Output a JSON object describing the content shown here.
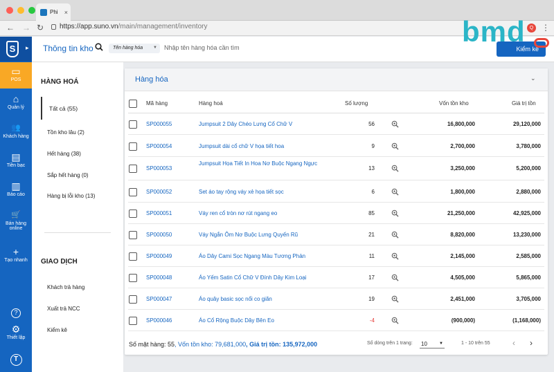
{
  "browser": {
    "tab_title": "Phi",
    "tab_close": "×",
    "url_host": "https://app.suno.vn",
    "url_path": "/main/management/inventory",
    "ext_badge": "Q",
    "back_icon": "←",
    "forward_icon": "→",
    "reload_icon": "↻",
    "menu_icon": "⋮"
  },
  "watermark": {
    "text": "bmd"
  },
  "sidebar": {
    "logo_letter": "S",
    "items": [
      {
        "icon": "monitor-icon",
        "glyph": "▭",
        "label": "POS"
      },
      {
        "icon": "home-icon",
        "glyph": "⌂",
        "label": "Quản lý"
      },
      {
        "icon": "users-icon",
        "glyph": "👥",
        "label": "Khách hàng"
      },
      {
        "icon": "card-icon",
        "glyph": "▤",
        "label": "Tiền bạc"
      },
      {
        "icon": "chart-icon",
        "glyph": "▥",
        "label": "Báo cáo"
      },
      {
        "icon": "cart-icon",
        "glyph": "🛒",
        "label": "Bán hàng online"
      },
      {
        "icon": "plus-icon",
        "glyph": "+",
        "label": "Tạo nhanh"
      },
      {
        "icon": "help-icon",
        "glyph": "?",
        "label": ""
      },
      {
        "icon": "gear-icon",
        "glyph": "⚙",
        "label": "Thiết lập"
      },
      {
        "icon": "user-icon",
        "glyph": "T",
        "label": ""
      }
    ],
    "accent": "#1565c0",
    "active_color": "#f9a825"
  },
  "header": {
    "title": "Thông tin kho",
    "search_type": "Tên hàng hóa",
    "search_placeholder": "Nhập tên hàng hóa cần tìm",
    "button_label": "Kiểm kê"
  },
  "categories": {
    "heading1": "HÀNG HOÁ",
    "items1": [
      "Tất cả (55)",
      "Tồn kho lâu (2)",
      "Hết hàng (38)",
      "Sắp hết hàng (0)",
      "Hàng bị lỗi kho (13)"
    ],
    "heading2": "GIAO DỊCH",
    "items2": [
      "Khách trả hàng",
      "Xuất trả NCC",
      "Kiểm kê"
    ]
  },
  "table": {
    "title": "Hàng hóa",
    "columns": [
      "Mã hàng",
      "Hàng hoá",
      "Số lượng",
      "Vốn tồn kho",
      "Giá trị tồn"
    ],
    "rows": [
      {
        "code": "SP000055",
        "name": "Jumpsuit 2 Dây Chéo Lưng Cổ Chữ V",
        "qty": "56",
        "cost": "16,800,000",
        "value": "29,120,000"
      },
      {
        "code": "SP000054",
        "name": "Jumpsuit dài cổ chữ V họa tiết hoa",
        "qty": "9",
        "cost": "2,700,000",
        "value": "3,780,000"
      },
      {
        "code": "SP000053",
        "name": "Jumpsuit Họa Tiết In Hoa Nơ Buộc Ngang Ngực",
        "qty": "13",
        "cost": "3,250,000",
        "value": "5,200,000"
      },
      {
        "code": "SP000052",
        "name": "Set áo tay rộng váy xẻ họa tiết sọc",
        "qty": "6",
        "cost": "1,800,000",
        "value": "2,880,000"
      },
      {
        "code": "SP000051",
        "name": "Váy ren cổ tròn nơ rút ngang eo",
        "qty": "85",
        "cost": "21,250,000",
        "value": "42,925,000"
      },
      {
        "code": "SP000050",
        "name": "Váy Ngắn Ôm Nơ Buộc Lưng Quyến Rũ",
        "qty": "21",
        "cost": "8,820,000",
        "value": "13,230,000"
      },
      {
        "code": "SP000049",
        "name": "Áo Dây Cami Sọc Ngang Màu Tương Phản",
        "qty": "11",
        "cost": "2,145,000",
        "value": "2,585,000"
      },
      {
        "code": "SP000048",
        "name": "Áo Yếm Satin Cổ Chữ V Đính Dây Kim Loại",
        "qty": "17",
        "cost": "4,505,000",
        "value": "5,865,000"
      },
      {
        "code": "SP000047",
        "name": "Áo quây basic sọc nổi co giãn",
        "qty": "19",
        "cost": "2,451,000",
        "value": "3,705,000"
      },
      {
        "code": "SP000046",
        "name": "Áo Cổ Rộng Buộc Dây Bên Eo",
        "qty": "-4",
        "cost": "(900,000)",
        "value": "(1,168,000)"
      }
    ]
  },
  "footer": {
    "count_label": "Số mặt hàng: 55",
    "cost_label": ", Vốn tồn kho: 79,681,000",
    "value_label": ", Giá trị tồn: 135,972,000",
    "rows_label": "Số dòng trên 1 trang:",
    "rows_value": "10",
    "range_label": "1 - 10 trên 55",
    "prev_icon": "‹",
    "next_icon": "›"
  }
}
